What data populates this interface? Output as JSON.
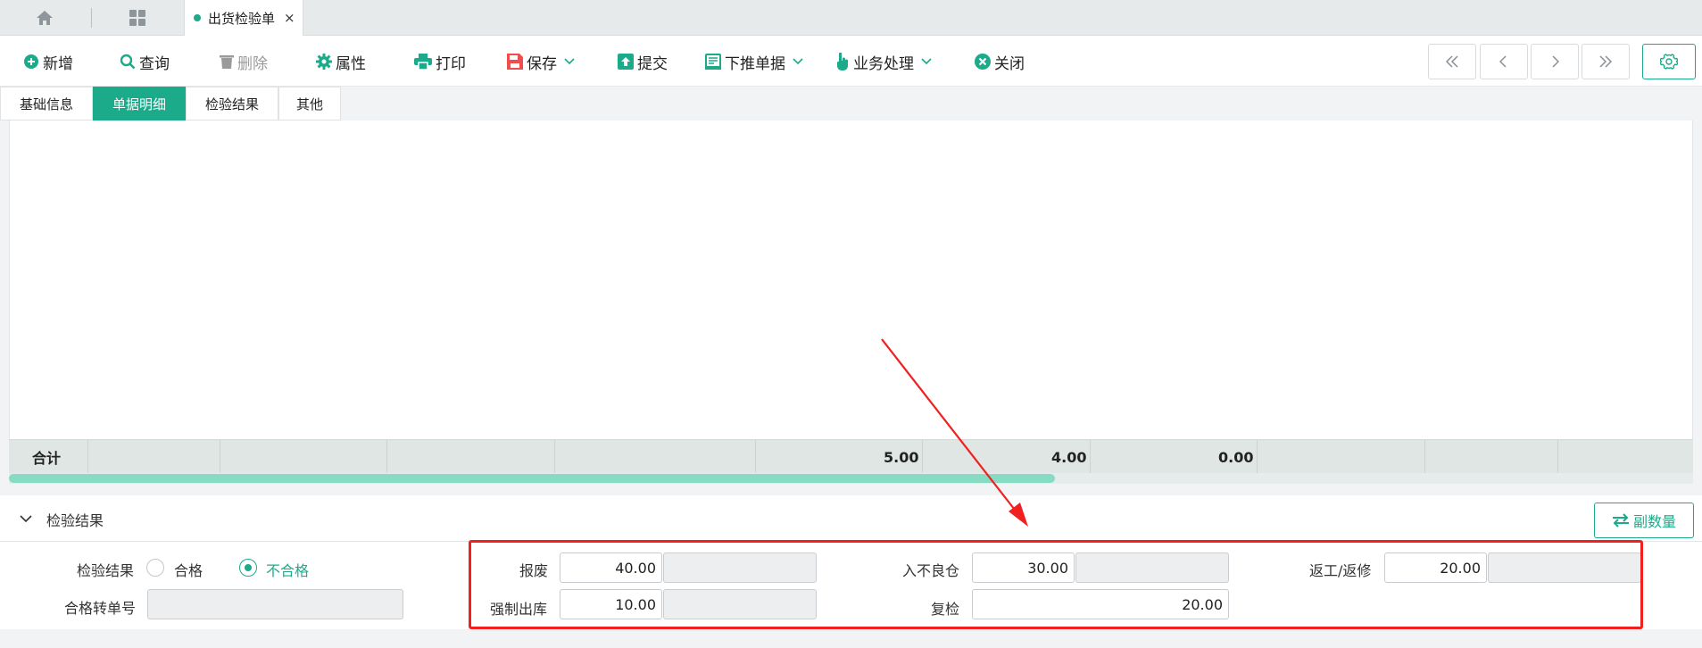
{
  "tabbar": {
    "home_icon": "home-icon",
    "grid_icon": "apps-grid-icon",
    "doc_tab": {
      "label": "出货检验单",
      "close": "×"
    }
  },
  "toolbar": {
    "buttons": [
      {
        "label": "新增",
        "icon": "plus-circle-icon"
      },
      {
        "label": "查询",
        "icon": "search-icon"
      },
      {
        "label": "删除",
        "icon": "trash-icon",
        "disabled": true
      },
      {
        "label": "属性",
        "icon": "gear-icon"
      },
      {
        "label": "打印",
        "icon": "printer-icon"
      },
      {
        "label": "保存",
        "icon": "save-icon",
        "dropdown": true
      },
      {
        "label": "提交",
        "icon": "upload-icon"
      },
      {
        "label": "下推单据",
        "icon": "document-icon",
        "dropdown": true
      },
      {
        "label": "业务处理",
        "icon": "hand-pointer-icon",
        "dropdown": true
      },
      {
        "label": "关闭",
        "icon": "close-circle-icon"
      }
    ],
    "nav": [
      "first-page-icon",
      "prev-page-icon",
      "next-page-icon",
      "last-page-icon"
    ],
    "settings_icon": "settings-icon"
  },
  "subtabs": [
    {
      "label": "基础信息",
      "active": false
    },
    {
      "label": "单据明细",
      "active": true
    },
    {
      "label": "检验结果",
      "active": false
    },
    {
      "label": "其他",
      "active": false
    }
  ],
  "grid": {
    "summary": {
      "label": "合计",
      "values": [
        "5.00",
        "4.00",
        "0.00"
      ]
    }
  },
  "result_section": {
    "title": "检验结果",
    "sub_qty_button": "副数量",
    "inspection_result": {
      "label": "检验结果",
      "options": [
        {
          "label": "合格",
          "selected": false
        },
        {
          "label": "不合格",
          "selected": true
        }
      ]
    },
    "transfer_no": {
      "label": "合格转单号",
      "value": ""
    },
    "fields": {
      "scrap": {
        "label": "报废",
        "value": "40.00"
      },
      "defect_store": {
        "label": "入不良仓",
        "value": "30.00"
      },
      "rework": {
        "label": "返工/返修",
        "value": "20.00"
      },
      "forced_out": {
        "label": "强制出库",
        "value": "10.00"
      },
      "recheck": {
        "label": "复检",
        "value": "20.00"
      }
    }
  },
  "colors": {
    "accent": "#1bab8a",
    "annotation": "#f02020"
  }
}
